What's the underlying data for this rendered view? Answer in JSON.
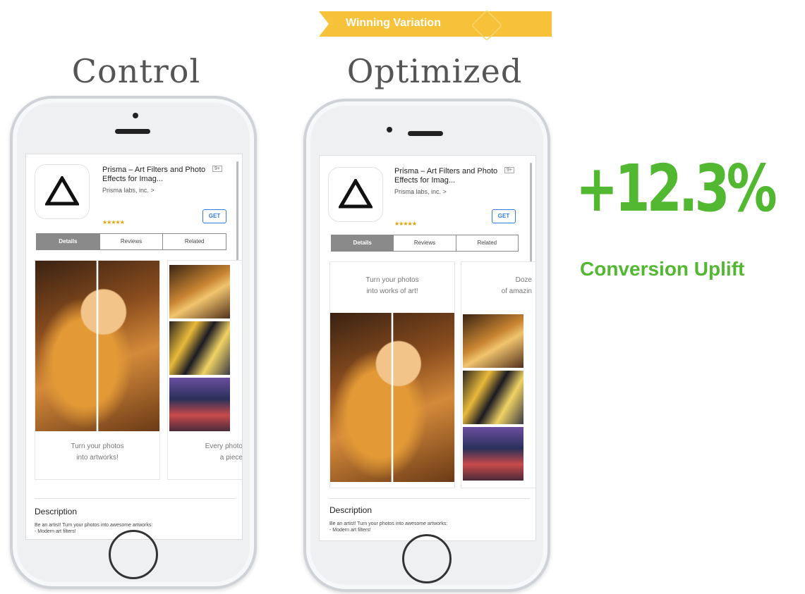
{
  "banner": {
    "label": "Winning Variation",
    "color": "#f6c23a"
  },
  "variants": {
    "control": {
      "title": "Control"
    },
    "optimized": {
      "title": "Optimized"
    }
  },
  "app": {
    "title": "Prisma – Art Filters and Photo Effects for Imag...",
    "developer": "Prisma labs, inc.",
    "age_rating": "9+",
    "stars": "★★★★★",
    "get_label": "GET",
    "tabs": [
      "Details",
      "Reviews",
      "Related"
    ],
    "description_title": "Description",
    "description_line1": "Be an artist! Turn your photos into awesome artworks:",
    "description_line2": "- Modern art filters!"
  },
  "control_captions": {
    "card1_line1": "Turn your photos",
    "card1_line2": "into artworks!",
    "card2_line1": "Every photo",
    "card2_line2": "a piece"
  },
  "optimized_captions": {
    "card1_line1": "Turn your photos",
    "card1_line2": "into works of art!",
    "card2_line1": "Doze",
    "card2_line2": "of amazin"
  },
  "result": {
    "value": "+12.3%",
    "label": "Conversion Uplift",
    "color": "#52b832"
  }
}
